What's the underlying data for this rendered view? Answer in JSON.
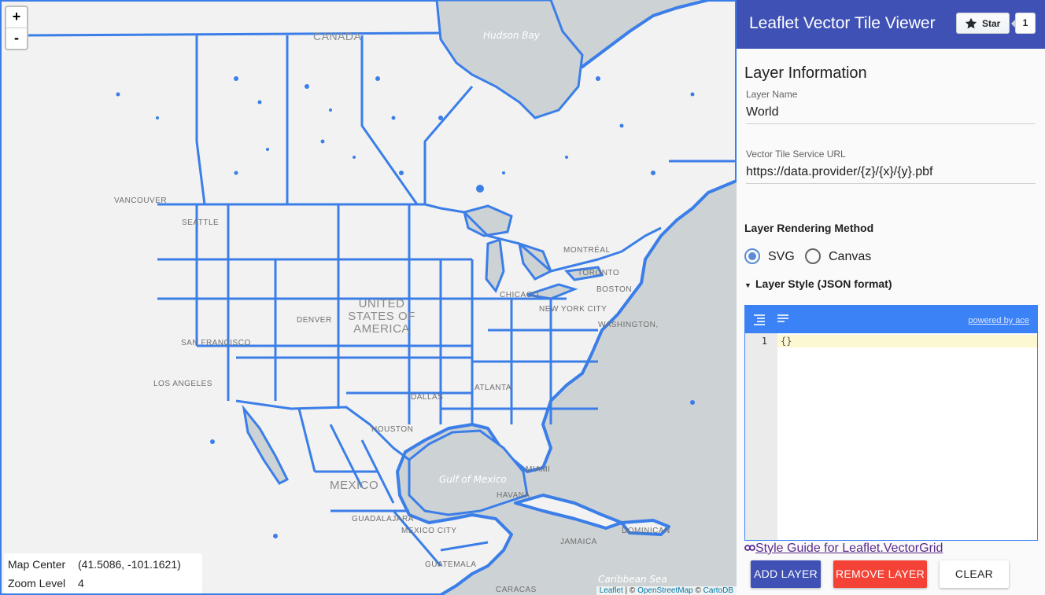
{
  "map": {
    "zoom_in": "+",
    "zoom_out": "-",
    "water_labels": [
      "Hudson Bay",
      "Gulf of Mexico",
      "Caribbean Sea"
    ],
    "country_labels": [
      "CANADA",
      "UNITED STATES OF AMERICA",
      "MEXICO"
    ],
    "places": [
      "VANCOUVER",
      "SEATTLE",
      "SAN FRANCISCO",
      "LOS ANGELES",
      "DENVER",
      "DALLAS",
      "HOUSTON",
      "ATLANTA",
      "MIAMI",
      "HAVANA",
      "CHICAGO",
      "TORONTO",
      "MONTRÉAL",
      "BOSTON",
      "NEW YORK CITY",
      "WASHINGTON,",
      "GUADALAJARA",
      "MEXICO CITY",
      "GUATEMALA",
      "JAMAICA",
      "DOMINICAN",
      "CARACAS"
    ],
    "info": {
      "center_label": "Map Center",
      "center_value": "(41.5086, -101.1621)",
      "zoom_label": "Zoom Level",
      "zoom_value": "4"
    },
    "attribution": {
      "leaflet": "Leaflet",
      "sep": " | © ",
      "osm": "OpenStreetMap",
      "sep2": " © ",
      "carto": "CartoDB"
    },
    "vector_color": "#3b7ee8",
    "land_color": "#f2f2f2",
    "water_color": "#cdd2d4"
  },
  "panel": {
    "app_title": "Leaflet Vector Tile Viewer",
    "github": {
      "star_label": "Star",
      "star_count": "1",
      "icon": "star-icon"
    },
    "section_title": "Layer Information",
    "layer_name_label": "Layer Name",
    "layer_name_value": "World",
    "url_label": "Vector Tile Service URL",
    "url_value": "https://data.provider/{z}/{x}/{y}.pbf",
    "rendering_label": "Layer Rendering Method",
    "rendering_options": [
      {
        "label": "SVG",
        "checked": true
      },
      {
        "label": "Canvas",
        "checked": false
      }
    ],
    "style_expander": "Layer Style (JSON format)",
    "editor": {
      "powered_by": "powered by ace",
      "line_number": "1",
      "content": "{}"
    },
    "style_guide_link": "Style Guide for Leaflet.VectorGrid",
    "buttons": {
      "add": "ADD LAYER",
      "remove": "REMOVE LAYER",
      "clear": "CLEAR"
    },
    "colors": {
      "header": "#3f51b5",
      "add": "#3f51b5",
      "remove": "#f44336",
      "accent": "#3b82f6"
    }
  }
}
